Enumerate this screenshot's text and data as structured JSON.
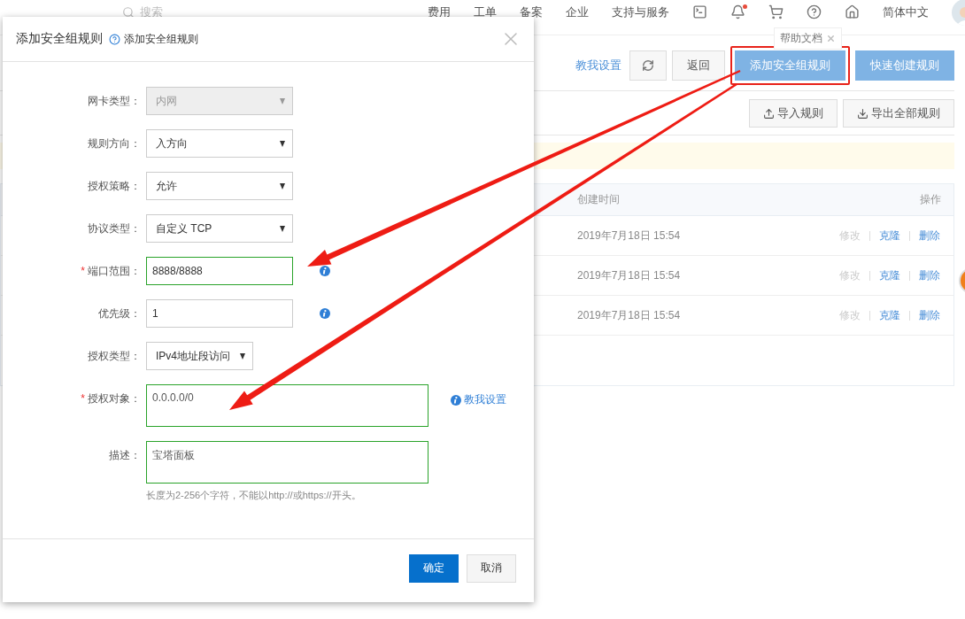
{
  "topbar": {
    "search_placeholder": "搜索",
    "nav": [
      "费用",
      "工单",
      "备案",
      "企业",
      "支持与服务"
    ],
    "notification_unread": true,
    "language": "简体中文"
  },
  "tooltip": {
    "text": "帮助文档"
  },
  "toolbar": {
    "help_link": "教我设置",
    "buttons": [
      {
        "label": "返回",
        "kind": "default",
        "highlighted": false
      },
      {
        "label": "添加安全组规则",
        "kind": "primary",
        "highlighted": true
      },
      {
        "label": "快速创建规则",
        "kind": "primary",
        "highlighted": false
      }
    ]
  },
  "secondary_buttons": [
    {
      "label": "导入规则",
      "kind": "import"
    },
    {
      "label": "导出全部规则",
      "kind": "export"
    }
  ],
  "table": {
    "columns": [
      "创建时间",
      "操作"
    ],
    "rows": [
      {
        "created": "2019年7月18日 15:54",
        "actions": [
          {
            "label": "修改",
            "disabled": true
          },
          {
            "label": "克隆",
            "disabled": false
          },
          {
            "label": "删除",
            "disabled": false
          }
        ]
      },
      {
        "created": "2019年7月18日 15:54",
        "actions": [
          {
            "label": "修改",
            "disabled": true
          },
          {
            "label": "克隆",
            "disabled": false
          },
          {
            "label": "删除",
            "disabled": false
          }
        ]
      },
      {
        "created": "2019年7月18日 15:54",
        "actions": [
          {
            "label": "修改",
            "disabled": true
          },
          {
            "label": "克隆",
            "disabled": false
          },
          {
            "label": "删除",
            "disabled": false
          }
        ]
      }
    ]
  },
  "dialog": {
    "title": "添加安全组规则",
    "help_link": "添加安全组规则",
    "fields": [
      {
        "kind": "select",
        "label": "网卡类型：",
        "value": "内网",
        "required": false,
        "disabled": true,
        "valid": false,
        "info": false
      },
      {
        "kind": "select",
        "label": "规则方向：",
        "value": "入方向",
        "required": false,
        "disabled": false,
        "valid": false,
        "info": false
      },
      {
        "kind": "select",
        "label": "授权策略：",
        "value": "允许",
        "required": false,
        "disabled": false,
        "valid": false,
        "info": false
      },
      {
        "kind": "select",
        "label": "协议类型：",
        "value": "自定义 TCP",
        "required": false,
        "disabled": false,
        "valid": false,
        "info": false
      },
      {
        "kind": "input",
        "required_mark": "*",
        "label": "端口范围：",
        "value": "8888/8888",
        "required": true,
        "disabled": false,
        "valid": true,
        "info": true
      },
      {
        "kind": "input",
        "label": "优先级：",
        "value": "1",
        "required": false,
        "disabled": false,
        "valid": false,
        "info": true
      },
      {
        "kind": "compact",
        "label": "授权类型：",
        "value": "IPv4地址段访问",
        "required": false,
        "disabled": false,
        "valid": false,
        "info": false
      },
      {
        "kind": "textarea",
        "required_mark": "*",
        "label": "授权对象：",
        "value": "0.0.0.0/0",
        "required": true,
        "disabled": false,
        "valid": true,
        "info": false,
        "link": "教我设置"
      },
      {
        "kind": "textarea",
        "label": "描述：",
        "value": "宝塔面板",
        "required": false,
        "disabled": false,
        "valid": true,
        "info": false,
        "hint": "长度为2-256个字符，不能以http://或https://开头。"
      }
    ],
    "buttons": [
      {
        "label": "确定",
        "kind": "primary"
      },
      {
        "label": "取消",
        "kind": "default"
      }
    ]
  }
}
